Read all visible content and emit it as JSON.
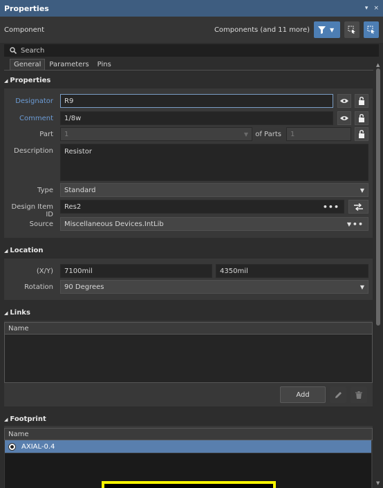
{
  "titlebar": {
    "title": "Properties",
    "pin_icon": "▾",
    "close_icon": "×"
  },
  "header": {
    "label": "Component",
    "selection": "Components (and 11 more)"
  },
  "search": {
    "placeholder": "Search"
  },
  "tabs": [
    {
      "label": "General"
    },
    {
      "label": "Parameters"
    },
    {
      "label": "Pins"
    }
  ],
  "properties": {
    "heading": "Properties",
    "designator_label": "Designator",
    "designator_value": "R9",
    "comment_label": "Comment",
    "comment_value": "1/8w",
    "part_label": "Part",
    "part_value": "1",
    "of_parts_label": "of Parts",
    "of_parts_value": "1",
    "description_label": "Description",
    "description_value": "Resistor",
    "type_label": "Type",
    "type_value": "Standard",
    "design_item_label": "Design Item ID",
    "design_item_value": "Res2",
    "source_label": "Source",
    "source_value": "Miscellaneous Devices.IntLib"
  },
  "location": {
    "heading": "Location",
    "xy_label": "(X/Y)",
    "x_value": "7100mil",
    "y_value": "4350mil",
    "rotation_label": "Rotation",
    "rotation_value": "90 Degrees"
  },
  "links": {
    "heading": "Links",
    "column_name": "Name",
    "add_label": "Add"
  },
  "footprint": {
    "heading": "Footprint",
    "column_name": "Name",
    "row_name": "AXIAL-0.4"
  },
  "colors": {
    "titlebar": "#3e5d80",
    "accent": "#4d7eb4",
    "selected_row": "#597fae",
    "footprint_outline": "#f5f300"
  }
}
